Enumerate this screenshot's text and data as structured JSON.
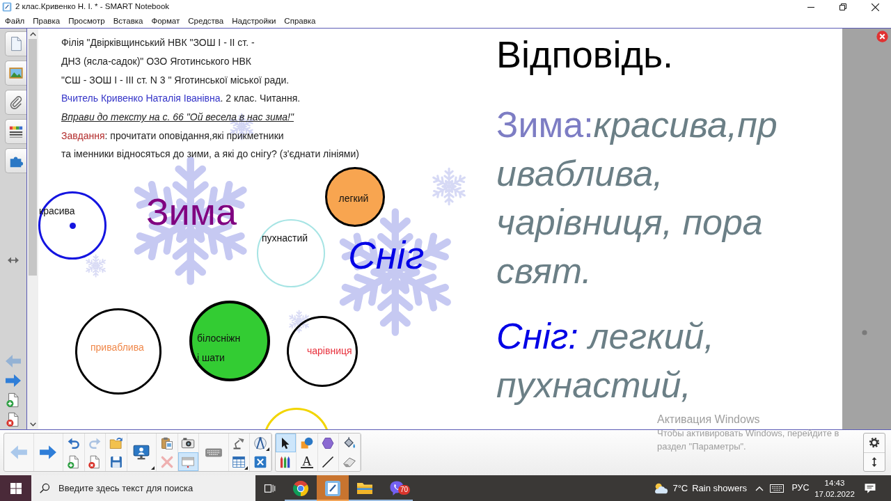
{
  "window": {
    "title": "2 клас.Кривенко Н. І. * - SMART Notebook"
  },
  "menu": [
    "Файл",
    "Правка",
    "Просмотр",
    "Вставка",
    "Формат",
    "Средства",
    "Надстройки",
    "Справка"
  ],
  "sidebar": {
    "tabs": [
      {
        "kind": "pages",
        "selected": false
      },
      {
        "kind": "gallery",
        "selected": false
      },
      {
        "kind": "attachments",
        "selected": false
      },
      {
        "kind": "properties",
        "selected": false
      },
      {
        "kind": "addons",
        "selected": false
      }
    ],
    "nav": [
      {
        "kind": "previous",
        "disabled": true
      },
      {
        "kind": "next",
        "disabled": false
      },
      {
        "kind": "add-page",
        "disabled": false
      },
      {
        "kind": "delete-page",
        "disabled": false
      }
    ]
  },
  "page": {
    "lines": [
      {
        "kind": "plain",
        "text": "Філія \"Двірківщинський НВК \"ЗОШ І - ІІ ст. -"
      },
      {
        "kind": "plain",
        "text": "ДНЗ (ясла-садок)\" ОЗО Яготинського НВК"
      },
      {
        "kind": "plain",
        "text": "\"СШ - ЗОШ І - ІІІ ст. N 3 \" Яготинської міської ради."
      },
      {
        "kind": "teacher",
        "lead": "Вчитель Кривенко Наталія Іванівна",
        "text": ". 2 клас. Читання."
      },
      {
        "kind": "heading",
        "text": "Вправи до тексту на с. 66 \"Ой весела в нас зима!\""
      },
      {
        "kind": "task",
        "lead": "Завдання",
        "text": ": прочитати оповідання,які прикметники"
      },
      {
        "kind": "plain",
        "text": "та іменники відносяться до зими, а які до снігу? (з'єднати лініями)"
      }
    ],
    "words": [
      {
        "text": "Зима",
        "color": "#800080",
        "italic": false
      },
      {
        "text": "Сніг",
        "color": "#0000e6",
        "italic": true
      }
    ],
    "circles": [
      {
        "color": "#1414e0",
        "label": {
          "text": "красива",
          "color": "#111111"
        },
        "dot": true
      },
      {
        "color": "#a6e4e4",
        "label": {
          "text": "пухнастий",
          "color": "#111111"
        },
        "dot": false
      },
      {
        "color": "#000000",
        "fill": {
          "color": "#f8a550"
        },
        "label": {
          "text": "легкий",
          "color": "#111111"
        },
        "dot": false
      },
      {
        "color": "#000000",
        "label": {
          "text": "приваблива",
          "color": "#f0884a"
        },
        "dot": false
      },
      {
        "color": "#000000",
        "fill": {
          "color": "#33cc33"
        },
        "label": {
          "text": "білосніжн\nі шати",
          "color": "#111111"
        },
        "dot": false
      },
      {
        "color": "#000000",
        "label": {
          "text": "чарівниця",
          "color": "#e8303c"
        },
        "dot": false
      },
      {
        "color": "#f2d500",
        "dot": false
      }
    ]
  },
  "answer": {
    "title": "Відповідь.",
    "items": [
      {
        "kind": "winter",
        "label": "Зима:",
        "text": "красива,приваблива, чарівниця, пора свят."
      },
      {
        "kind": "snow",
        "label": "Сніг:",
        "text": " легкий, пухнастий,"
      }
    ]
  },
  "toolbar": {
    "groups": [
      {
        "columns": [
          [
            {
              "kind": "back",
              "selected": false,
              "disabled": true
            }
          ],
          [
            {
              "kind": "forward",
              "selected": false,
              "disabled": false
            }
          ],
          [
            {
              "kind": "undo",
              "selected": false,
              "disabled": false
            },
            {
              "kind": "add-page",
              "selected": false,
              "disabled": false
            }
          ],
          [
            {
              "kind": "redo",
              "selected": false,
              "disabled": true
            },
            {
              "kind": "delete-page",
              "selected": false,
              "disabled": false
            }
          ],
          [
            {
              "kind": "open",
              "selected": false,
              "disabled": false
            },
            {
              "kind": "save",
              "selected": false,
              "disabled": false
            }
          ],
          [
            {
              "kind": "screen",
              "selected": false,
              "disabled": false
            }
          ],
          [
            {
              "kind": "paste",
              "selected": false,
              "disabled": false
            },
            {
              "kind": "delete",
              "selected": false,
              "disabled": true
            }
          ],
          [
            {
              "kind": "capture",
              "selected": false,
              "disabled": false
            },
            {
              "kind": "shade",
              "selected": true,
              "disabled": false
            }
          ],
          [
            {
              "kind": "keyboard",
              "selected": false,
              "disabled": false
            }
          ],
          [
            {
              "kind": "doc-camera",
              "selected": false,
              "disabled": false
            },
            {
              "kind": "table",
              "selected": false,
              "disabled": false
            }
          ],
          [
            {
              "kind": "measure",
              "selected": false,
              "disabled": false
            },
            {
              "kind": "fullscreen",
              "selected": false,
              "disabled": false
            }
          ]
        ]
      },
      {
        "columns": [
          [
            {
              "kind": "select",
              "selected": true,
              "disabled": false
            },
            {
              "kind": "pens",
              "selected": false,
              "disabled": false
            }
          ],
          [
            {
              "kind": "shapes",
              "selected": false,
              "disabled": false
            },
            {
              "kind": "text",
              "glyph": "A",
              "selected": false,
              "disabled": false
            }
          ],
          [
            {
              "kind": "polygon",
              "selected": false,
              "disabled": false
            },
            {
              "kind": "line",
              "selected": false,
              "disabled": false
            }
          ],
          [
            {
              "kind": "fill",
              "selected": false,
              "disabled": false
            },
            {
              "kind": "eraser",
              "selected": false,
              "disabled": false
            }
          ]
        ]
      }
    ]
  },
  "side_buttons": [
    {
      "kind": "settings"
    },
    {
      "kind": "resize"
    }
  ],
  "activation_notice": {
    "title": "Активация Windows",
    "text": "Чтобы активировать Windows, перейдите в раздел \"Параметры\"."
  },
  "taskbar": {
    "search": {
      "placeholder": "Введите здесь текст для поиска"
    },
    "apps": [
      {
        "kind": "browser",
        "running": true,
        "selected": false
      },
      {
        "kind": "notebook",
        "running": true,
        "selected": true
      },
      {
        "kind": "folder",
        "running": true,
        "selected": false
      },
      {
        "kind": "messenger",
        "running": true,
        "selected": false,
        "badge": "70"
      }
    ],
    "weather": {
      "temperature": "7°C",
      "condition": "Rain showers"
    },
    "language": "РУС",
    "time": "14:43",
    "date": "17.02.2022"
  }
}
